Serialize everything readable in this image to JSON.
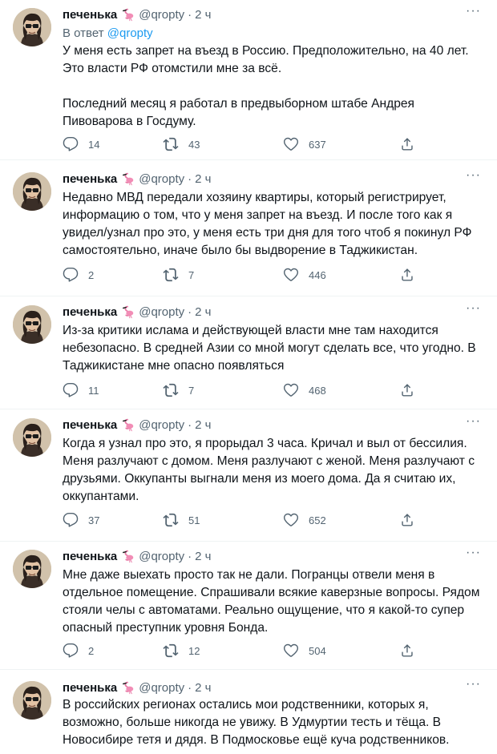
{
  "thread": {
    "author": {
      "name": "печенька",
      "handle": "@qropty",
      "avatar_icon": "profile-photo",
      "emoji_icon": "flamingo-icon"
    },
    "reply_prefix": "В ответ",
    "reply_to": "@qropty",
    "tweets": [
      {
        "time": "2 ч",
        "text": "У меня есть запрет на въезд в Россию. Предположительно, на 40 лет. Это власти РФ отомстили мне за всё.\n\nПоследний месяц я работал в предвыборном штабе Андрея Пивоварова в Госдуму.",
        "replies": "14",
        "retweets": "43",
        "likes": "637"
      },
      {
        "time": "2 ч",
        "text": "Недавно МВД передали хозяину квартиры, который регистрирует, информацию о том, что у меня запрет на въезд. И после того как я увидел/узнал про это, у меня есть три дня для того чтоб я покинул РФ самостоятельно, иначе было бы выдворение в Таджикистан.",
        "replies": "2",
        "retweets": "7",
        "likes": "446"
      },
      {
        "time": "2 ч",
        "text": "Из-за критики ислама и действующей власти мне там находится небезопасно. В средней Азии со мной могут сделать все, что угодно. В Таджикистане мне опасно появляться",
        "replies": "11",
        "retweets": "7",
        "likes": "468"
      },
      {
        "time": "2 ч",
        "text": "Когда я узнал про это, я прорыдал 3 часа. Кричал и выл от бессилия. Меня разлучают с домом. Меня разлучают с женой. Меня разлучают с друзьями. Оккупанты выгнали меня из моего дома. Да я считаю их, оккупантами.",
        "replies": "37",
        "retweets": "51",
        "likes": "652"
      },
      {
        "time": "2 ч",
        "text": "Мне даже выехать просто так не дали. Погранцы отвели меня в отдельное помещение. Спрашивали всякие каверзные вопросы. Рядом стояли челы с автоматами. Реально ощущение, что я какой-то супер опасный преступник уровня Бонда.",
        "replies": "2",
        "retweets": "12",
        "likes": "504"
      },
      {
        "time": "2 ч",
        "text": "В российских регионах остались мои родственники, которых я, возможно, больше никогда не увижу. В Удмуртии тесть и тёща. В Новосибире тетя и дядя. В Подмосковье ещё куча родственников."
      }
    ],
    "colors": {
      "text": "#0f1419",
      "muted": "#536471",
      "link": "#1d9bf0",
      "divider": "#eff3f4"
    }
  }
}
